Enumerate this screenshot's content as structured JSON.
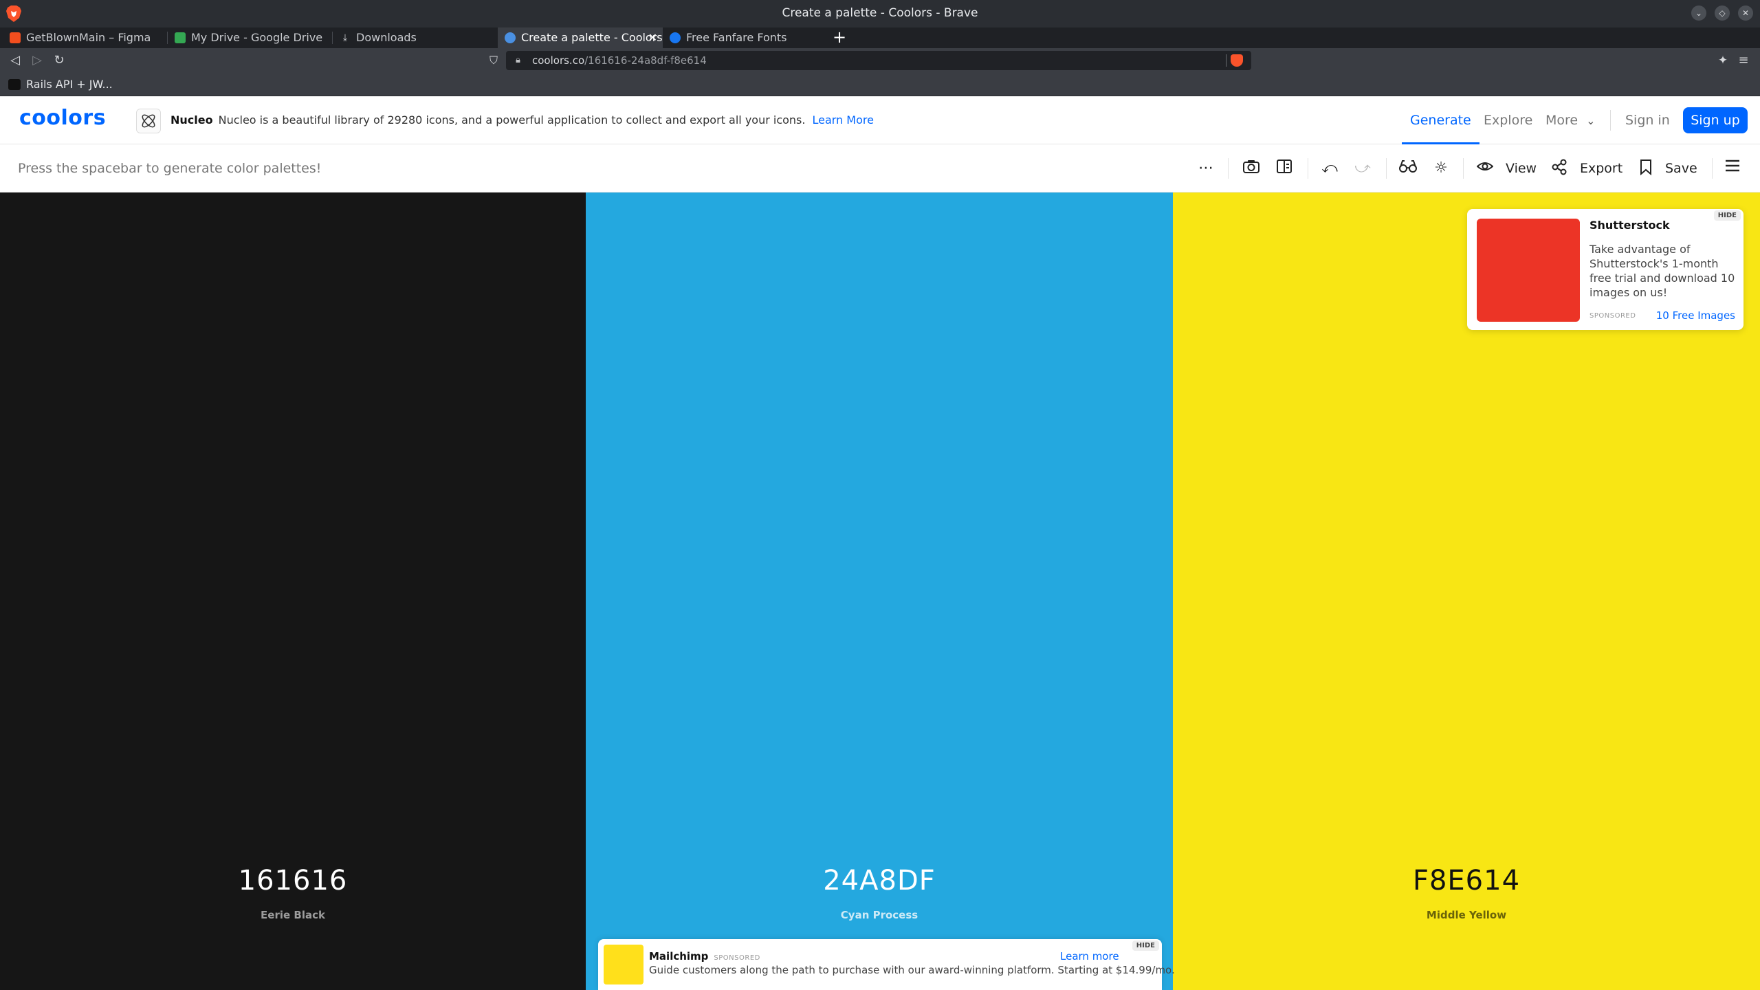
{
  "window": {
    "title": "Create a palette - Coolors - Brave",
    "controls": [
      "⌄",
      "◇",
      "✕"
    ]
  },
  "tabs": [
    {
      "label": "GetBlownMain – Figma",
      "favicon_color": "#f24e1e"
    },
    {
      "label": "My Drive - Google Drive",
      "favicon_color": "#34a853"
    },
    {
      "label": "Downloads",
      "favicon_color": "#c9cbcf"
    },
    {
      "label": "Create a palette - Coolors",
      "favicon_color": "#4a90e2",
      "active": true
    },
    {
      "label": "Free Fanfare Fonts",
      "favicon_color": "#1877f2"
    }
  ],
  "address_bar": {
    "domain": "coolors.co",
    "path": "/161616-24a8df-f8e614"
  },
  "bookmarks": [
    {
      "label": "Rails API + JW..."
    }
  ],
  "header": {
    "logo": "coolors",
    "ad": {
      "name": "Nucleo",
      "text": "Nucleo is a beautiful library of 29280 icons, and a powerful application to collect and export all your icons.",
      "link": "Learn More"
    },
    "nav": {
      "generate": "Generate",
      "explore": "Explore",
      "more": "More",
      "sign_in": "Sign in",
      "sign_up": "Sign up"
    }
  },
  "toolbar": {
    "hint": "Press the spacebar to generate color palettes!",
    "view_label": "View",
    "export_label": "Export",
    "save_label": "Save"
  },
  "palette": [
    {
      "hex": "161616",
      "name": "Eerie Black",
      "color": "#161616"
    },
    {
      "hex": "24A8DF",
      "name": "Cyan Process",
      "color": "#24a8df"
    },
    {
      "hex": "F8E614",
      "name": "Middle Yellow",
      "color": "#f8e614"
    }
  ],
  "ads": {
    "shutterstock": {
      "brand": "Shutterstock",
      "body": " Take advantage of Shutterstock's 1-month free trial and download 10 images on us!",
      "sponsored": "SPONSORED",
      "cta": "10 Free Images",
      "hide": "HIDE",
      "image_color": "#ec3426"
    },
    "mailchimp": {
      "brand": "Mailchimp",
      "sponsored": "SPONSORED",
      "body": "Guide customers along the path to purchase with our award-winning platform. Starting at $14.99/mo.",
      "cta": "Learn more",
      "hide": "HIDE",
      "image_color": "#ffe01b"
    }
  },
  "accent_color": "#0066ff"
}
